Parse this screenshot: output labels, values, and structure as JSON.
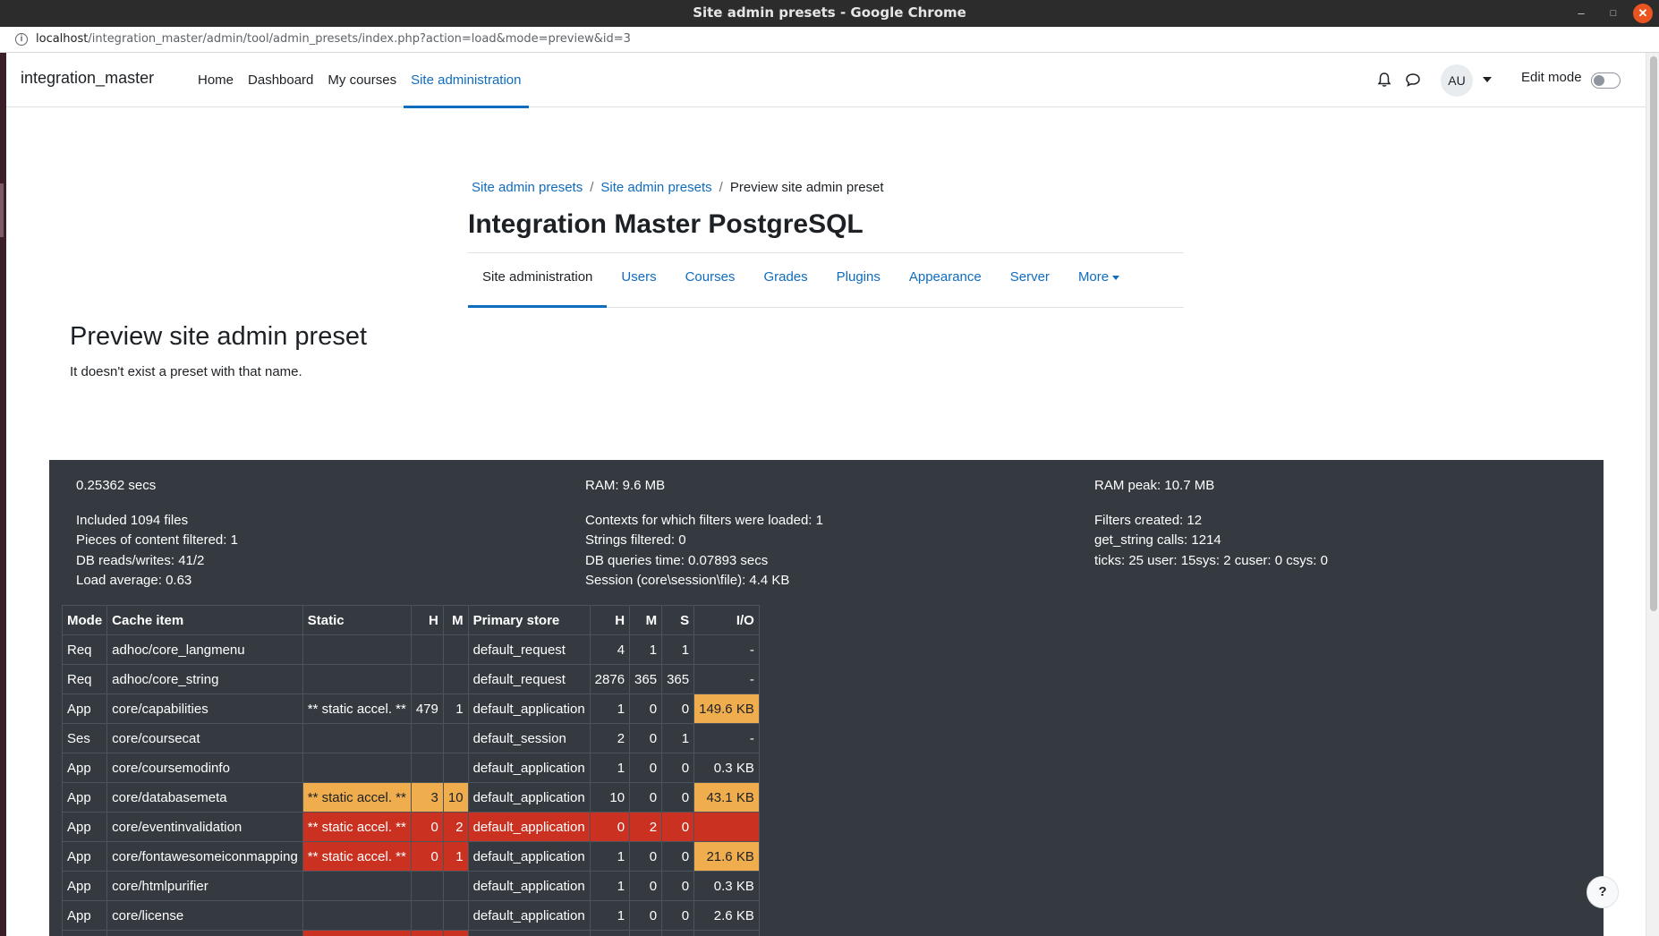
{
  "window": {
    "title": "Site admin presets - Google Chrome",
    "url_host": "localhost",
    "url_path": "/integration_master/admin/tool/admin_presets/index.php?action=load&mode=preview&id=3"
  },
  "navbar": {
    "brand": "integration_master",
    "items": [
      {
        "label": "Home"
      },
      {
        "label": "Dashboard"
      },
      {
        "label": "My courses"
      },
      {
        "label": "Site administration"
      }
    ],
    "avatar_initials": "AU",
    "edit_mode_label": "Edit mode"
  },
  "breadcrumb": [
    "Site admin presets",
    "Site admin presets",
    "Preview site admin preset"
  ],
  "page_heading": "Integration Master PostgreSQL",
  "secondary_nav": [
    {
      "label": "Site administration"
    },
    {
      "label": "Users"
    },
    {
      "label": "Courses"
    },
    {
      "label": "Grades"
    },
    {
      "label": "Plugins"
    },
    {
      "label": "Appearance"
    },
    {
      "label": "Server"
    },
    {
      "label": "More"
    }
  ],
  "main": {
    "title": "Preview site admin preset",
    "message": "It doesn't exist a preset with that name."
  },
  "perf": {
    "col1": [
      "0.25362 secs",
      "Included 1094 files",
      "Pieces of content filtered: 1",
      "DB reads/writes: 41/2",
      "Load average: 0.63"
    ],
    "col2": [
      "RAM: 9.6 MB",
      "Contexts for which filters were loaded: 1",
      "Strings filtered: 0",
      "DB queries time: 0.07893 secs",
      "Session (core\\session\\file): 4.4 KB"
    ],
    "col3": [
      "RAM peak: 10.7 MB",
      "Filters created: 12",
      "get_string calls: 1214",
      "ticks: 25 user: 15sys: 2 cuser: 0 csys: 0"
    ]
  },
  "cache_table": {
    "headers": [
      "Mode",
      "Cache item",
      "Static",
      "H",
      "M",
      "Primary store",
      "H",
      "M",
      "S",
      "I/O"
    ],
    "rows": [
      {
        "mode": "Req",
        "item": "adhoc/core_langmenu",
        "static": "",
        "sh": "",
        "sm": "",
        "store": "default_request",
        "h": "4",
        "m": "1",
        "s": "1",
        "io": "-",
        "static_status": "",
        "store_status": "",
        "io_status": ""
      },
      {
        "mode": "Req",
        "item": "adhoc/core_string",
        "static": "",
        "sh": "",
        "sm": "",
        "store": "default_request",
        "h": "2876",
        "m": "365",
        "s": "365",
        "io": "-",
        "static_status": "",
        "store_status": "",
        "io_status": ""
      },
      {
        "mode": "App",
        "item": "core/capabilities",
        "static": "** static accel. **",
        "sh": "479",
        "sm": "1",
        "store": "default_application",
        "h": "1",
        "m": "0",
        "s": "0",
        "io": "149.6 KB",
        "static_status": "",
        "store_status": "",
        "io_status": "warn"
      },
      {
        "mode": "Ses",
        "item": "core/coursecat",
        "static": "",
        "sh": "",
        "sm": "",
        "store": "default_session",
        "h": "2",
        "m": "0",
        "s": "1",
        "io": "-",
        "static_status": "",
        "store_status": "",
        "io_status": ""
      },
      {
        "mode": "App",
        "item": "core/coursemodinfo",
        "static": "",
        "sh": "",
        "sm": "",
        "store": "default_application",
        "h": "1",
        "m": "0",
        "s": "0",
        "io": "0.3 KB",
        "static_status": "",
        "store_status": "",
        "io_status": ""
      },
      {
        "mode": "App",
        "item": "core/databasemeta",
        "static": "** static accel. **",
        "sh": "3",
        "sm": "10",
        "store": "default_application",
        "h": "10",
        "m": "0",
        "s": "0",
        "io": "43.1 KB",
        "static_status": "warn",
        "store_status": "",
        "io_status": "warn"
      },
      {
        "mode": "App",
        "item": "core/eventinvalidation",
        "static": "** static accel. **",
        "sh": "0",
        "sm": "2",
        "store": "default_application",
        "h": "0",
        "m": "2",
        "s": "0",
        "io": "",
        "static_status": "bad",
        "store_status": "bad",
        "io_status": "bad"
      },
      {
        "mode": "App",
        "item": "core/fontawesomeiconmapping",
        "static": "** static accel. **",
        "sh": "0",
        "sm": "1",
        "store": "default_application",
        "h": "1",
        "m": "0",
        "s": "0",
        "io": "21.6 KB",
        "static_status": "bad",
        "store_status": "",
        "io_status": "warn"
      },
      {
        "mode": "App",
        "item": "core/htmlpurifier",
        "static": "",
        "sh": "",
        "sm": "",
        "store": "default_application",
        "h": "1",
        "m": "0",
        "s": "0",
        "io": "0.3 KB",
        "static_status": "",
        "store_status": "",
        "io_status": ""
      },
      {
        "mode": "App",
        "item": "core/license",
        "static": "",
        "sh": "",
        "sm": "",
        "store": "default_application",
        "h": "1",
        "m": "0",
        "s": "0",
        "io": "2.6 KB",
        "static_status": "",
        "store_status": "",
        "io_status": ""
      }
    ]
  },
  "help_label": "?",
  "colors": {
    "accent": "#0f6cbf",
    "footer_bg": "#343a40",
    "warn": "#f0ad4e",
    "bad": "#ca3120"
  }
}
